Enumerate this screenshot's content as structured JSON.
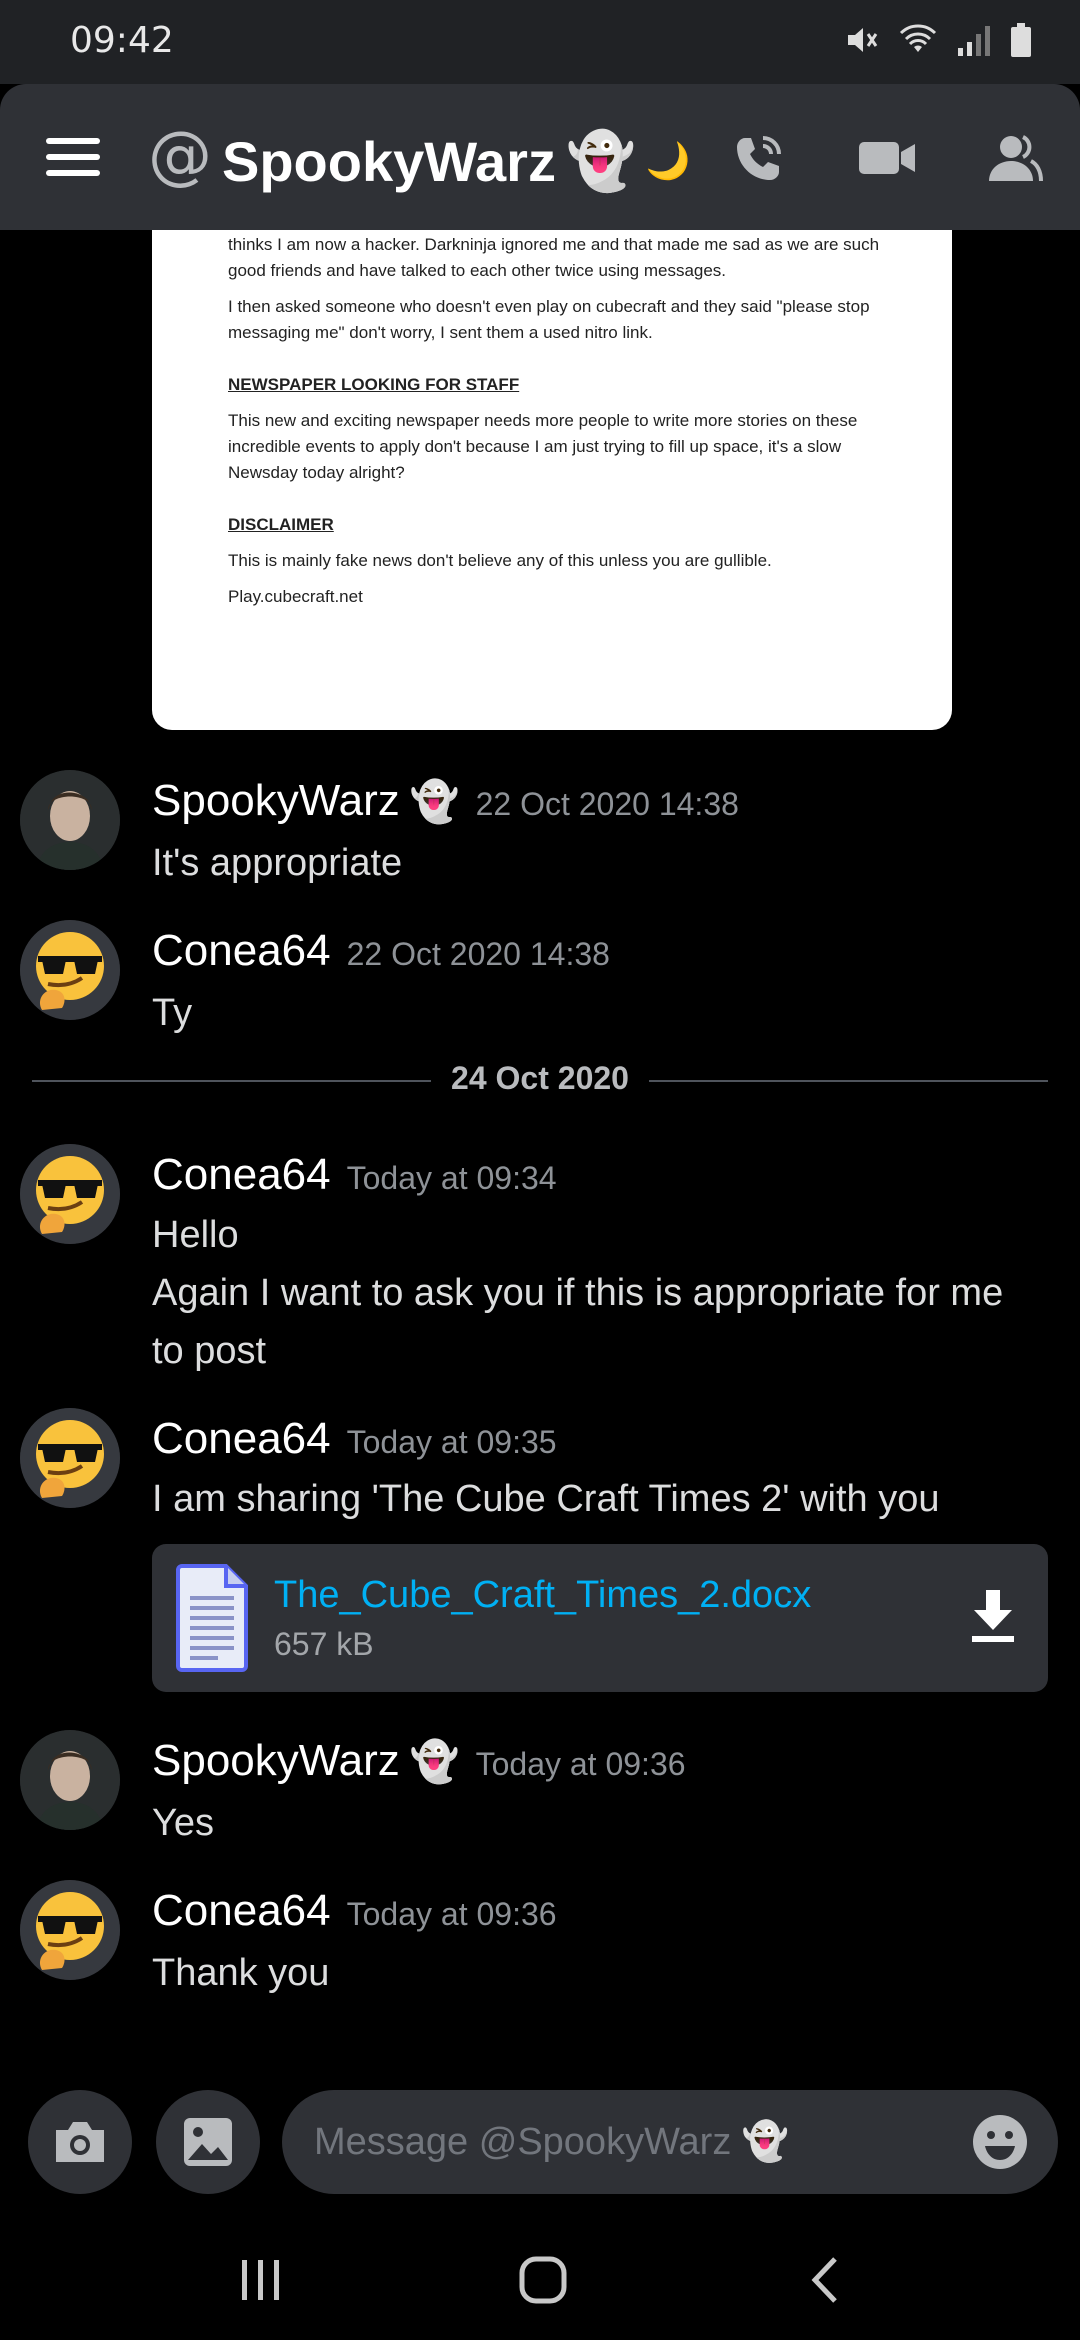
{
  "status_bar": {
    "time": "09:42"
  },
  "header": {
    "at_symbol": "@",
    "title": "SpookyWarz",
    "title_emoji": "👻",
    "moon_emoji": "🌙"
  },
  "document_preview": {
    "para1": "thinks I am now a hacker. Darkninja ignored me and that made me sad as we are such good friends and have talked to each other twice using messages.",
    "para2": "I then asked someone who doesn't even play on cubecraft and they said \"please stop messaging me\" don't worry, I sent them a used nitro link.",
    "heading1": "NEWSPAPER LOOKING FOR STAFF",
    "para3": "This new and exciting newspaper needs more people to write more stories on these incredible events to apply don't because I am just trying to fill up space, it's a slow Newsday today alright?",
    "heading2": "DISCLAIMER",
    "para4": "This is mainly fake news don't believe  any of this unless you are gullible.",
    "para5": "Play.cubecraft.net"
  },
  "messages": [
    {
      "author": "SpookyWarz",
      "author_emoji": "👻",
      "time": "22 Oct 2020 14:38",
      "lines": [
        "It's appropriate"
      ]
    },
    {
      "author": "Conea64",
      "time": "22 Oct 2020 14:38",
      "lines": [
        "Ty"
      ]
    },
    {
      "author": "Conea64",
      "time": "Today at 09:34",
      "lines": [
        "Hello",
        "Again I want to ask you if this is appropriate for me to post"
      ]
    },
    {
      "author": "Conea64",
      "time": "Today at 09:35",
      "lines": [
        "I am sharing 'The Cube Craft Times 2' with you"
      ]
    },
    {
      "author": "SpookyWarz",
      "author_emoji": "👻",
      "time": "Today at 09:36",
      "lines": [
        "Yes"
      ]
    },
    {
      "author": "Conea64",
      "time": "Today at 09:36",
      "lines": [
        "Thank you"
      ]
    }
  ],
  "date_divider": "24 Oct 2020",
  "attachment": {
    "file_name": "The_Cube_Craft_Times_2.docx",
    "file_size": "657 kB"
  },
  "input": {
    "placeholder": "Message @SpookyWarz 👻"
  },
  "colors": {
    "link": "#00b0f4",
    "background": "#000000",
    "panel": "#2f3136",
    "muted": "#8e9297"
  },
  "icons": [
    "hamburger-icon",
    "phone-call-icon",
    "video-camera-icon",
    "members-icon",
    "file-document-icon",
    "download-icon",
    "camera-icon",
    "image-icon",
    "emoji-icon",
    "recent-apps-icon",
    "home-icon",
    "back-icon"
  ]
}
